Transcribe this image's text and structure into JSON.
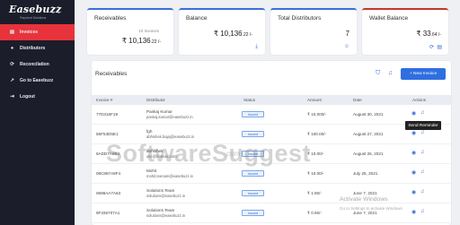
{
  "brand": {
    "logo_text": "Easebuzz",
    "logo_sub": "Payment Solutions"
  },
  "sidebar": {
    "items": [
      {
        "label": "Invoices",
        "icon": "document-icon",
        "active": true
      },
      {
        "label": "Distributors",
        "icon": "users-icon",
        "active": false
      },
      {
        "label": "Reconcilation",
        "icon": "sync-icon",
        "active": false
      },
      {
        "label": "Go to Easebuzz",
        "icon": "external-link-icon",
        "active": false
      },
      {
        "label": "Logout",
        "icon": "logout-icon",
        "active": false
      }
    ]
  },
  "cards": {
    "receivables": {
      "label": "Receivables",
      "sub": "10 Invoices",
      "amount": "₹ 10,136",
      "decimal": ".22 /-",
      "color": "#3b6fd8"
    },
    "balance": {
      "label": "Balance",
      "amount": "₹ 10,136",
      "decimal": ".22 /-",
      "color": "#3b6fd8"
    },
    "distributors": {
      "label": "Total Distributors",
      "value": "7",
      "color": "#3b6fd8"
    },
    "wallet": {
      "label": "Wallet Balance",
      "amount": "₹ 33",
      "decimal": ".64 /-",
      "color": "#c0392b"
    }
  },
  "table": {
    "title": "Receivables",
    "new_button": "+ New Invoice",
    "headers": [
      "Invoice #",
      "Distributor",
      "Status",
      "Amount",
      "Date",
      "Actions"
    ],
    "rows": [
      {
        "invoice": "77D316F19",
        "name": "Pankaj Kumar",
        "email": "pankaj.kumar@easebuzz.in",
        "status": "Issued",
        "amount": "₹ 10,000/-",
        "date": "August 30, 2021"
      },
      {
        "invoice": "55F53D5E1",
        "name": "fgh",
        "email": "abhishek.bajaj@easebuzz.in",
        "status": "Issued",
        "amount": "₹ 100.00/-",
        "date": "August 27, 2021"
      },
      {
        "invoice": "9ADD7A6B4",
        "name": "abhishek",
        "email": "abc@hotmail.com",
        "status": "Issued",
        "amount": "₹ 10.00/-",
        "date": "August 26, 2021"
      },
      {
        "invoice": "08C887A8F4",
        "name": "Mohit",
        "email": "mohit.teenam@easebuzz.in",
        "status": "Issued",
        "amount": "₹ 10.00/-",
        "date": "July 25, 2021"
      },
      {
        "invoice": "0698AA7A63",
        "name": "Solutions Team",
        "email": "solutions@easebuzz.in",
        "status": "Issued",
        "amount": "₹ 1.90/-",
        "date": "June 7, 2021"
      },
      {
        "invoice": "9F336707A1",
        "name": "Solutions Team",
        "email": "solutions@easebuzz.in",
        "status": "Issued",
        "amount": "₹ 0.90/-",
        "date": "June 7, 2021"
      }
    ]
  },
  "tooltip": "Send Reminder",
  "watermark": {
    "text": "SoftwareSuggest",
    "url": ".com",
    "activate_title": "Activate Windows",
    "activate_sub": "Go to Settings to activate Windows."
  }
}
